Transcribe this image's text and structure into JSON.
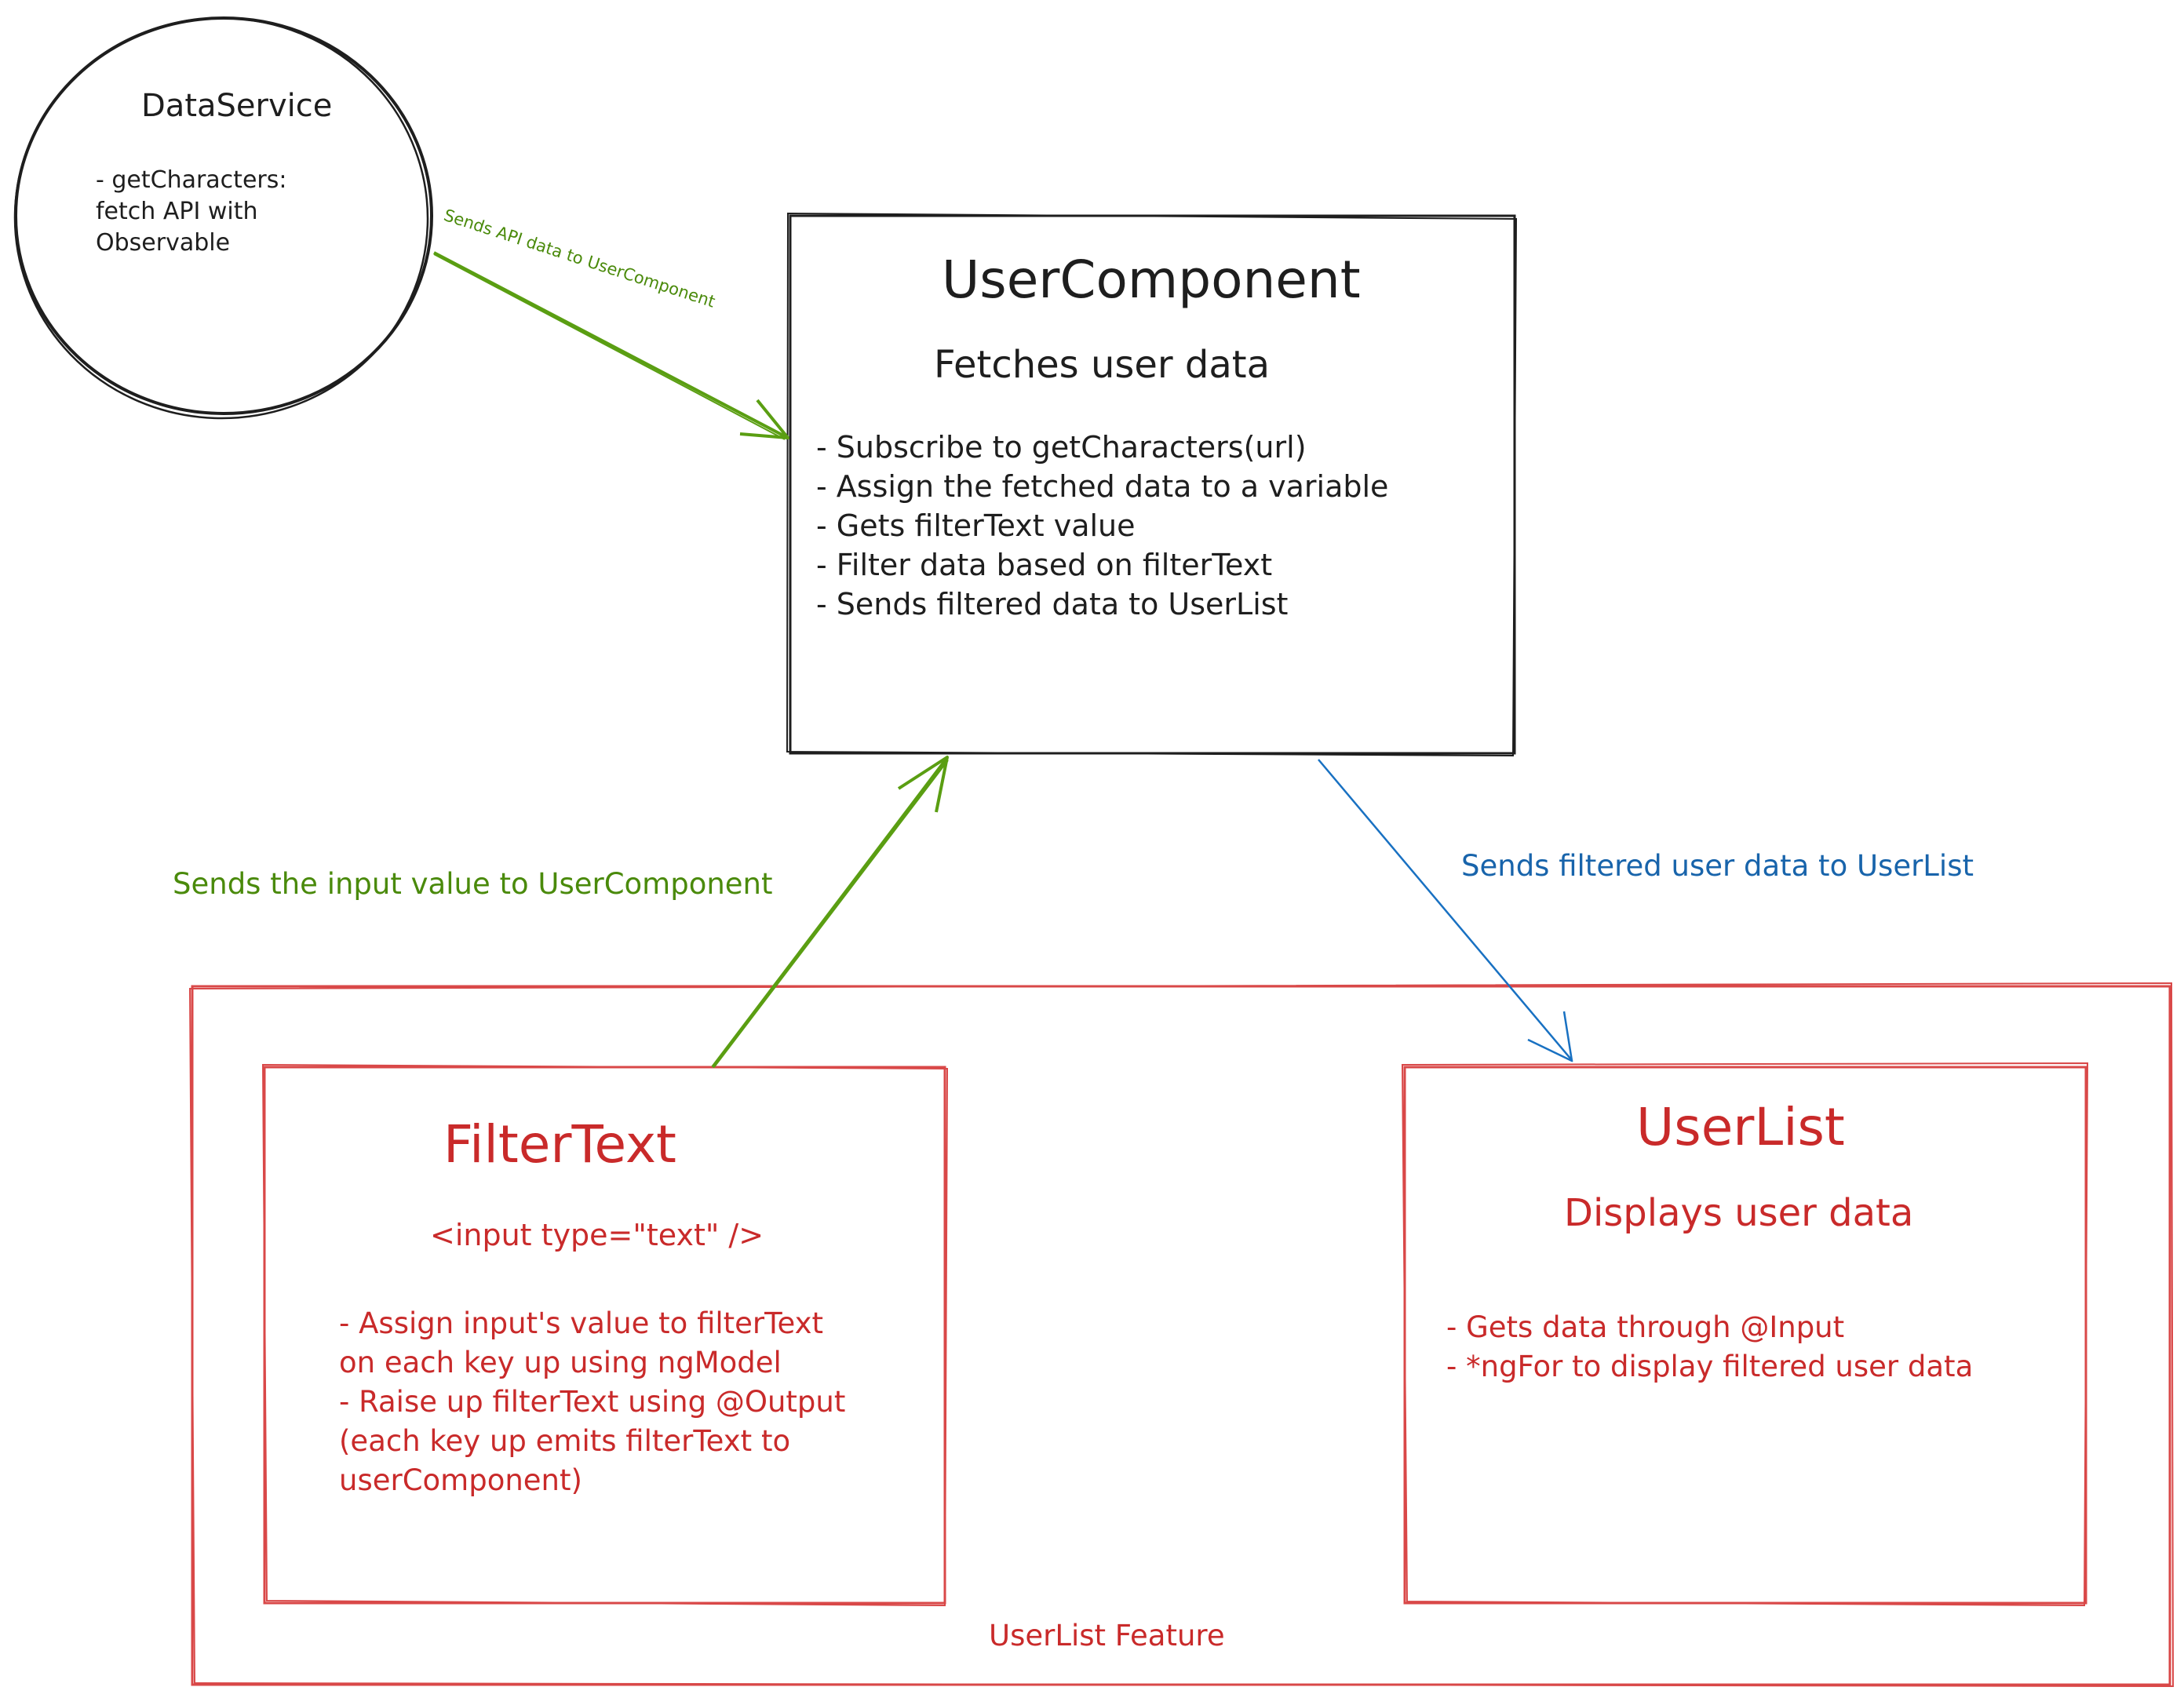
{
  "colors": {
    "ink": "#1e1e1e",
    "red": "#c92a2a",
    "green": "#4a8a0b",
    "blue": "#1864ab",
    "background": "#ffffff"
  },
  "data_service": {
    "title": "DataService",
    "lines": [
      "- getCharacters:",
      "fetch API with",
      "Observable"
    ]
  },
  "user_component": {
    "title": "UserComponent",
    "subtitle": "Fetches user data",
    "lines": [
      "- Subscribe to getCharacters(url)",
      "- Assign the fetched data to a variable",
      "- Gets filterText value",
      "- Filter data based on filterText",
      "- Sends filtered data to UserList"
    ]
  },
  "filter_text": {
    "title": "FilterText",
    "subtitle": "<input type=\"text\" />",
    "lines": [
      "- Assign input's value to filterText",
      "on each key up using ngModel",
      "- Raise up filterText using @Output",
      "(each key up emits filterText to",
      "userComponent)"
    ]
  },
  "user_list": {
    "title": "UserList",
    "subtitle": "Displays user data",
    "lines": [
      "- Gets data through @Input",
      "- *ngFor to display filtered user data"
    ]
  },
  "feature_group": {
    "label": "UserList Feature"
  },
  "arrows": {
    "service_to_component": "Sends API data to UserComponent",
    "filter_to_component": "Sends the input value to UserComponent",
    "component_to_list": "Sends filtered user data to UserList"
  }
}
